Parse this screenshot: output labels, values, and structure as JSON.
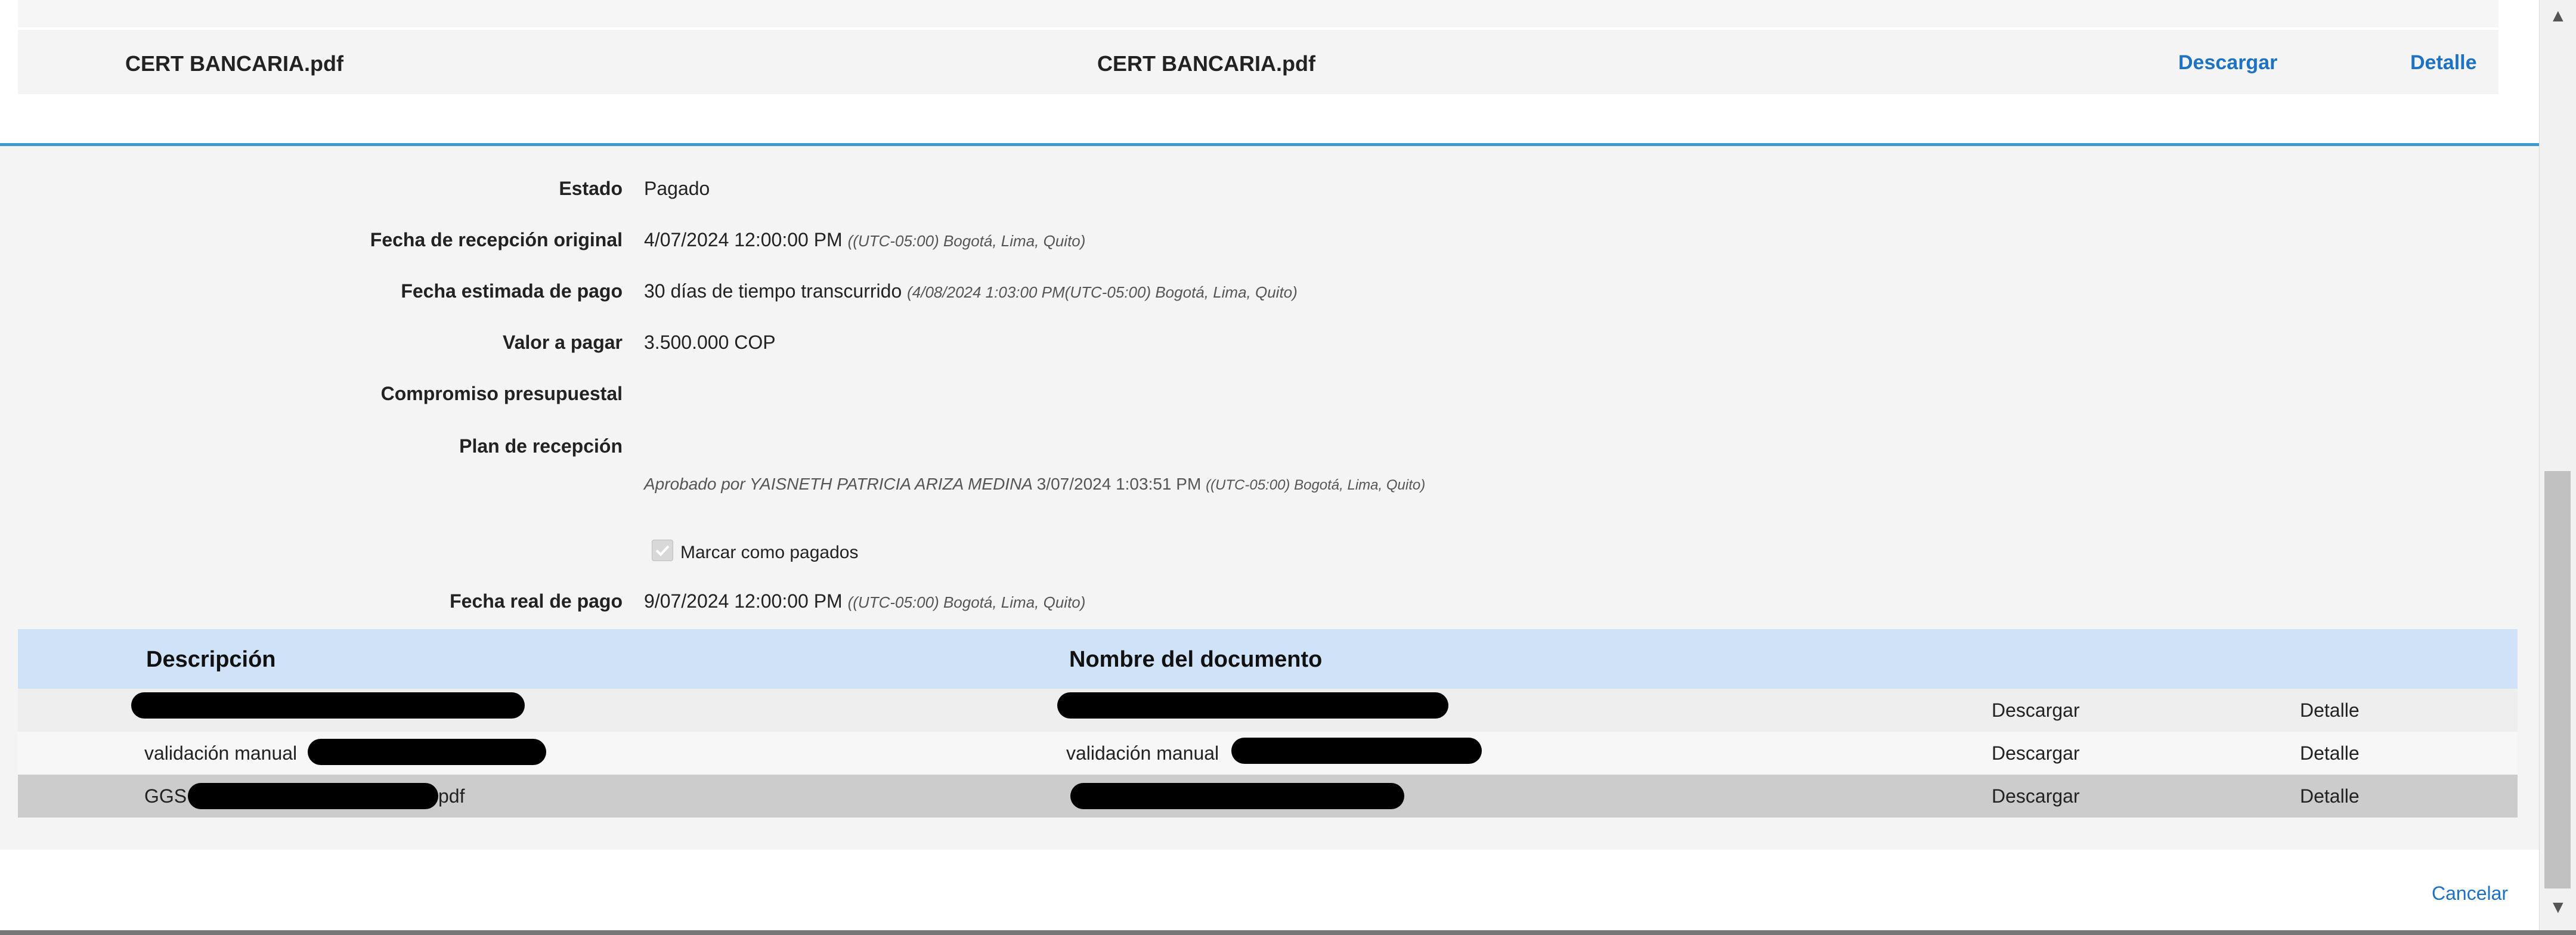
{
  "top_row": {
    "description": "CERT BANCARIA.pdf",
    "document_name": "CERT BANCARIA.pdf",
    "download_label": "Descargar",
    "detail_label": "Detalle"
  },
  "details": {
    "estado_label": "Estado",
    "estado_value": "Pagado",
    "fecha_recepcion_label": "Fecha de recepción original",
    "fecha_recepcion_value": "4/07/2024 12:00:00 PM",
    "fecha_recepcion_tz": "((UTC-05:00) Bogotá, Lima, Quito)",
    "fecha_estimada_label": "Fecha estimada de pago",
    "fecha_estimada_value": "30 días de tiempo transcurrido",
    "fecha_estimada_note": "(4/08/2024 1:03:00 PM(UTC-05:00) Bogotá, Lima, Quito)",
    "valor_label": "Valor a pagar",
    "valor_value": "3.500.000 COP",
    "compromiso_label": "Compromiso presupuestal",
    "plan_label": "Plan de recepción",
    "aprobado_text": "Aprobado por YAISNETH PATRICIA ARIZA MEDINA",
    "aprobado_date": "3/07/2024 1:03:51 PM",
    "aprobado_tz": "((UTC-05:00) Bogotá, Lima, Quito)",
    "marcar_label": "Marcar como pagados",
    "marcar_checked": true,
    "fecha_real_label": "Fecha real de pago",
    "fecha_real_value": "9/07/2024 12:00:00 PM",
    "fecha_real_tz": "((UTC-05:00) Bogotá, Lima, Quito)"
  },
  "table": {
    "headers": [
      "Descripción",
      "Nombre del documento"
    ],
    "rows": [
      {
        "description": "",
        "document_name": "",
        "download": "Descargar",
        "detail": "Detalle",
        "bg": "#eeeeee"
      },
      {
        "description": "validación manual",
        "document_name": "validación manual",
        "download": "Descargar",
        "detail": "Detalle",
        "bg": "#f7f7f7"
      },
      {
        "description": "GGS",
        "description_suffix": "pdf",
        "document_name": "",
        "download": "Descargar",
        "detail": "Detalle",
        "bg": "#cccccc"
      }
    ]
  },
  "footer": {
    "cancel_label": "Cancelar"
  },
  "colors": {
    "accent": "#3a9ad1",
    "link": "#1d72c4",
    "table_header_bg": "#cfe2f8",
    "panel_bg": "#f4f4f4"
  },
  "icons": {
    "scroll_up": "scroll-up-arrow-icon",
    "scroll_down": "scroll-down-arrow-icon"
  }
}
